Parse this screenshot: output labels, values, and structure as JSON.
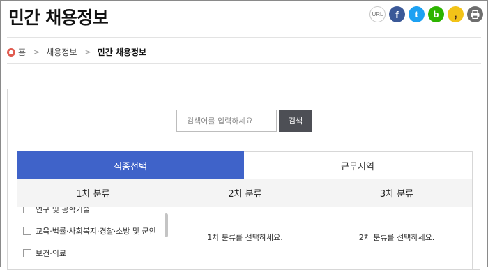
{
  "header": {
    "title": "민간 채용정보"
  },
  "share": {
    "url_label": "URL",
    "icons": [
      "url-icon",
      "facebook-icon",
      "twitter-icon",
      "blog-icon",
      "kakaostory-icon",
      "print-icon"
    ]
  },
  "breadcrumb": {
    "home": "홈",
    "item1": "채용정보",
    "current": "민간 채용정보"
  },
  "search": {
    "placeholder": "검색어를 입력하세요",
    "button": "검색"
  },
  "tabs": {
    "job_type": "직종선택",
    "work_area": "근무지역"
  },
  "columns": {
    "first": "1차 분류",
    "second": "2차 분류",
    "third": "3차 분류"
  },
  "messages": {
    "second": "1차 분류를 선택하세요.",
    "third": "2차 분류를 선택하세요."
  },
  "categories": [
    "연구 및 공학기술",
    "교육·법률·사회복지·경찰·소방 및 군인",
    "보건·의료"
  ],
  "colors": {
    "tab_active": "#3f63c9",
    "search_button": "#4d4f55",
    "home_icon": "#e05a4e"
  }
}
